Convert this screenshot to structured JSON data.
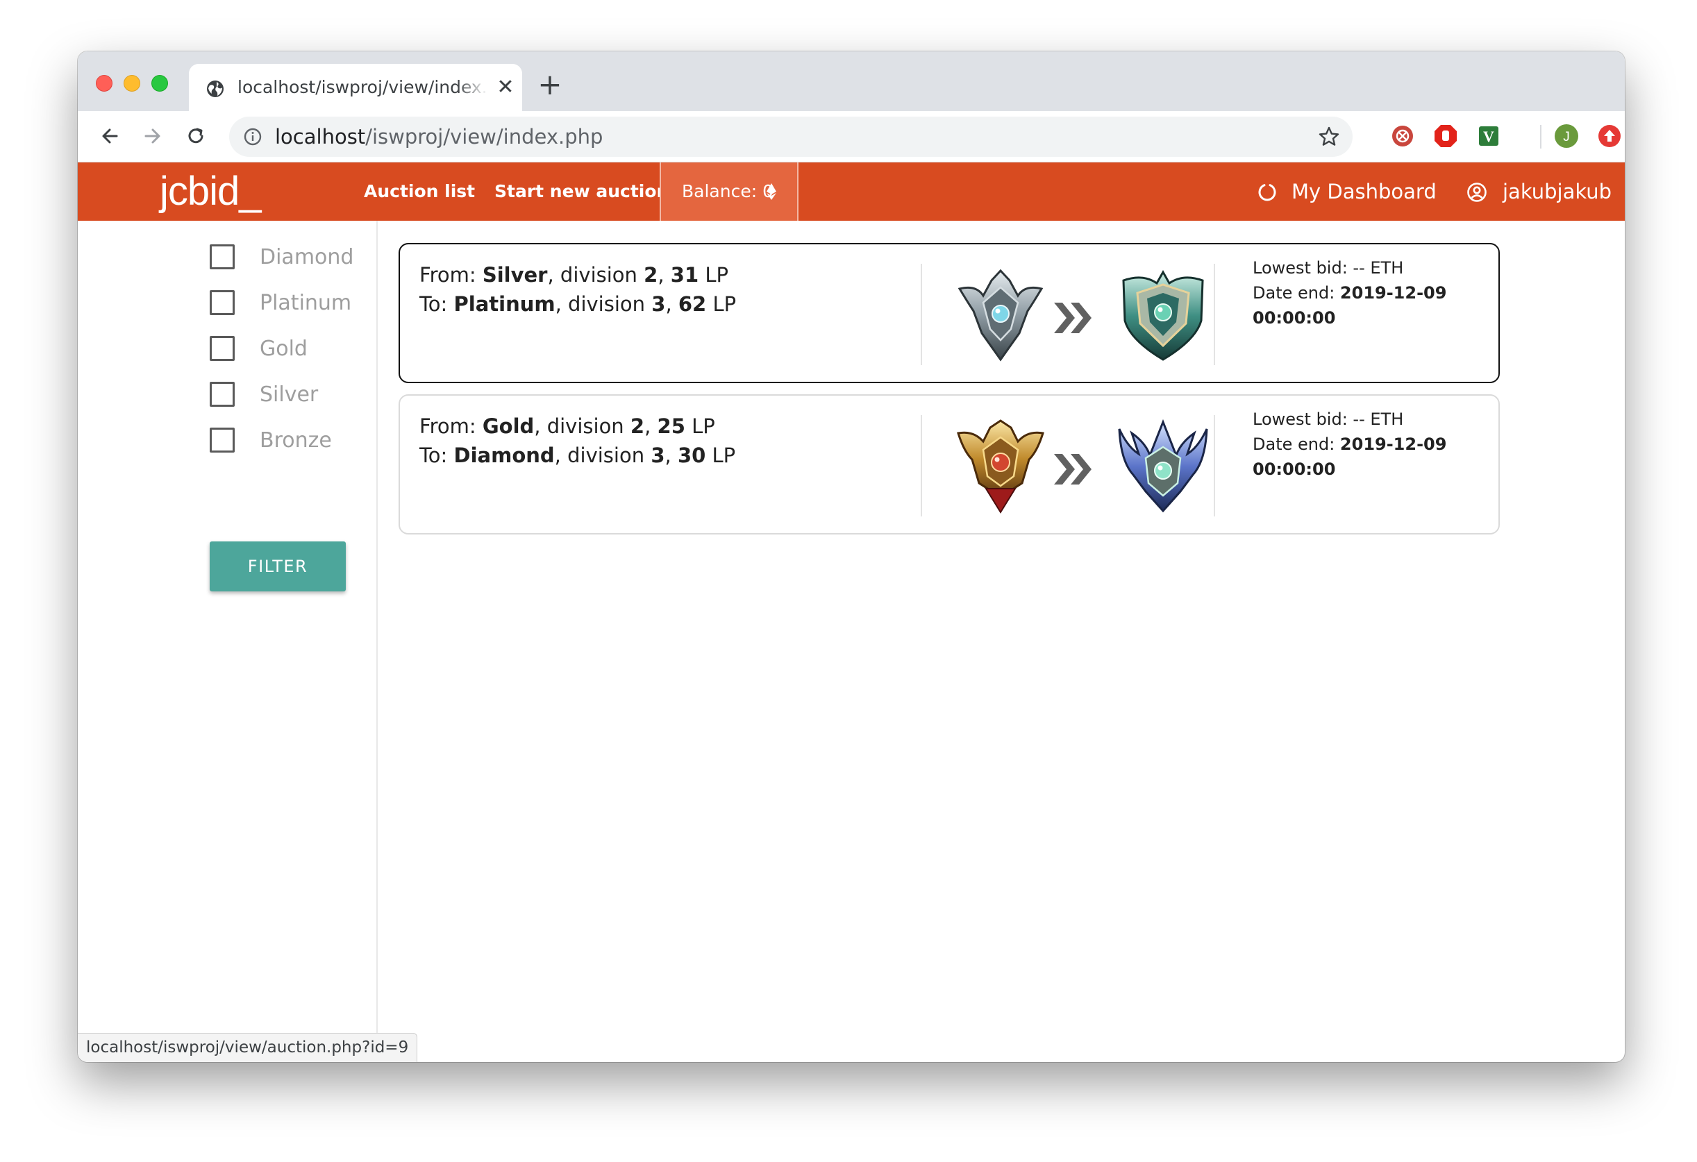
{
  "browser": {
    "tab_title": "localhost/iswproj/view/index.php",
    "url_host": "localhost",
    "url_path": "/iswproj/view/index.php",
    "status_url": "localhost/iswproj/view/auction.php?id=9",
    "icons": [
      "globe-icon",
      "close-icon",
      "plus-icon",
      "back-icon",
      "forward-icon",
      "reload-icon",
      "info-icon",
      "star-icon"
    ],
    "extensions": [
      {
        "name": "extension-red-circle-icon",
        "color": "#c9463d"
      },
      {
        "name": "extension-stop-hand-icon",
        "color": "#e2231a"
      },
      {
        "name": "extension-v-icon",
        "color": "#2d7d3a",
        "text": "V"
      },
      {
        "name": "profile-avatar",
        "color": "#6a9a3c",
        "text": "J"
      },
      {
        "name": "extension-upload-icon",
        "color": "#e53935"
      }
    ]
  },
  "site": {
    "logo": "jcbid_",
    "nav": {
      "auction_list": "Auction list",
      "start_new_auction": "Start new auction",
      "balance": "Balance: 0",
      "my_dashboard": "My Dashboard",
      "username": "jakubjakub"
    },
    "colors": {
      "brand": "#d84b20",
      "balance_bg": "#e4663f",
      "filter_button": "#4da69b"
    }
  },
  "filters": {
    "options": [
      {
        "label": "Diamond",
        "checked": false
      },
      {
        "label": "Platinum",
        "checked": false
      },
      {
        "label": "Gold",
        "checked": false
      },
      {
        "label": "Silver",
        "checked": false
      },
      {
        "label": "Bronze",
        "checked": false
      }
    ],
    "button": "FILTER"
  },
  "auctions": [
    {
      "from_prefix": "From: ",
      "from_tier": "Silver",
      "from_div_label": ", division ",
      "from_division": "2",
      "from_lp": "31",
      "from_lp_suffix": " LP",
      "to_prefix": "To: ",
      "to_tier": "Platinum",
      "to_div_label": ", division ",
      "to_division": "3",
      "to_lp": "62",
      "to_lp_suffix": " LP",
      "from_emblem": "silver-emblem-icon",
      "to_emblem": "platinum-emblem-icon",
      "lowest_bid": "Lowest bid: -- ETH",
      "date_label": "Date end: ",
      "date_value": "2019-12-09",
      "time_value": "00:00:00"
    },
    {
      "from_prefix": "From: ",
      "from_tier": "Gold",
      "from_div_label": ", division ",
      "from_division": "2",
      "from_lp": "25",
      "from_lp_suffix": " LP",
      "to_prefix": "To: ",
      "to_tier": "Diamond",
      "to_div_label": ", division ",
      "to_division": "3",
      "to_lp": "30",
      "to_lp_suffix": " LP",
      "from_emblem": "gold-emblem-icon",
      "to_emblem": "diamond-emblem-icon",
      "lowest_bid": "Lowest bid: -- ETH",
      "date_label": "Date end: ",
      "date_value": "2019-12-09",
      "time_value": "00:00:00"
    }
  ]
}
